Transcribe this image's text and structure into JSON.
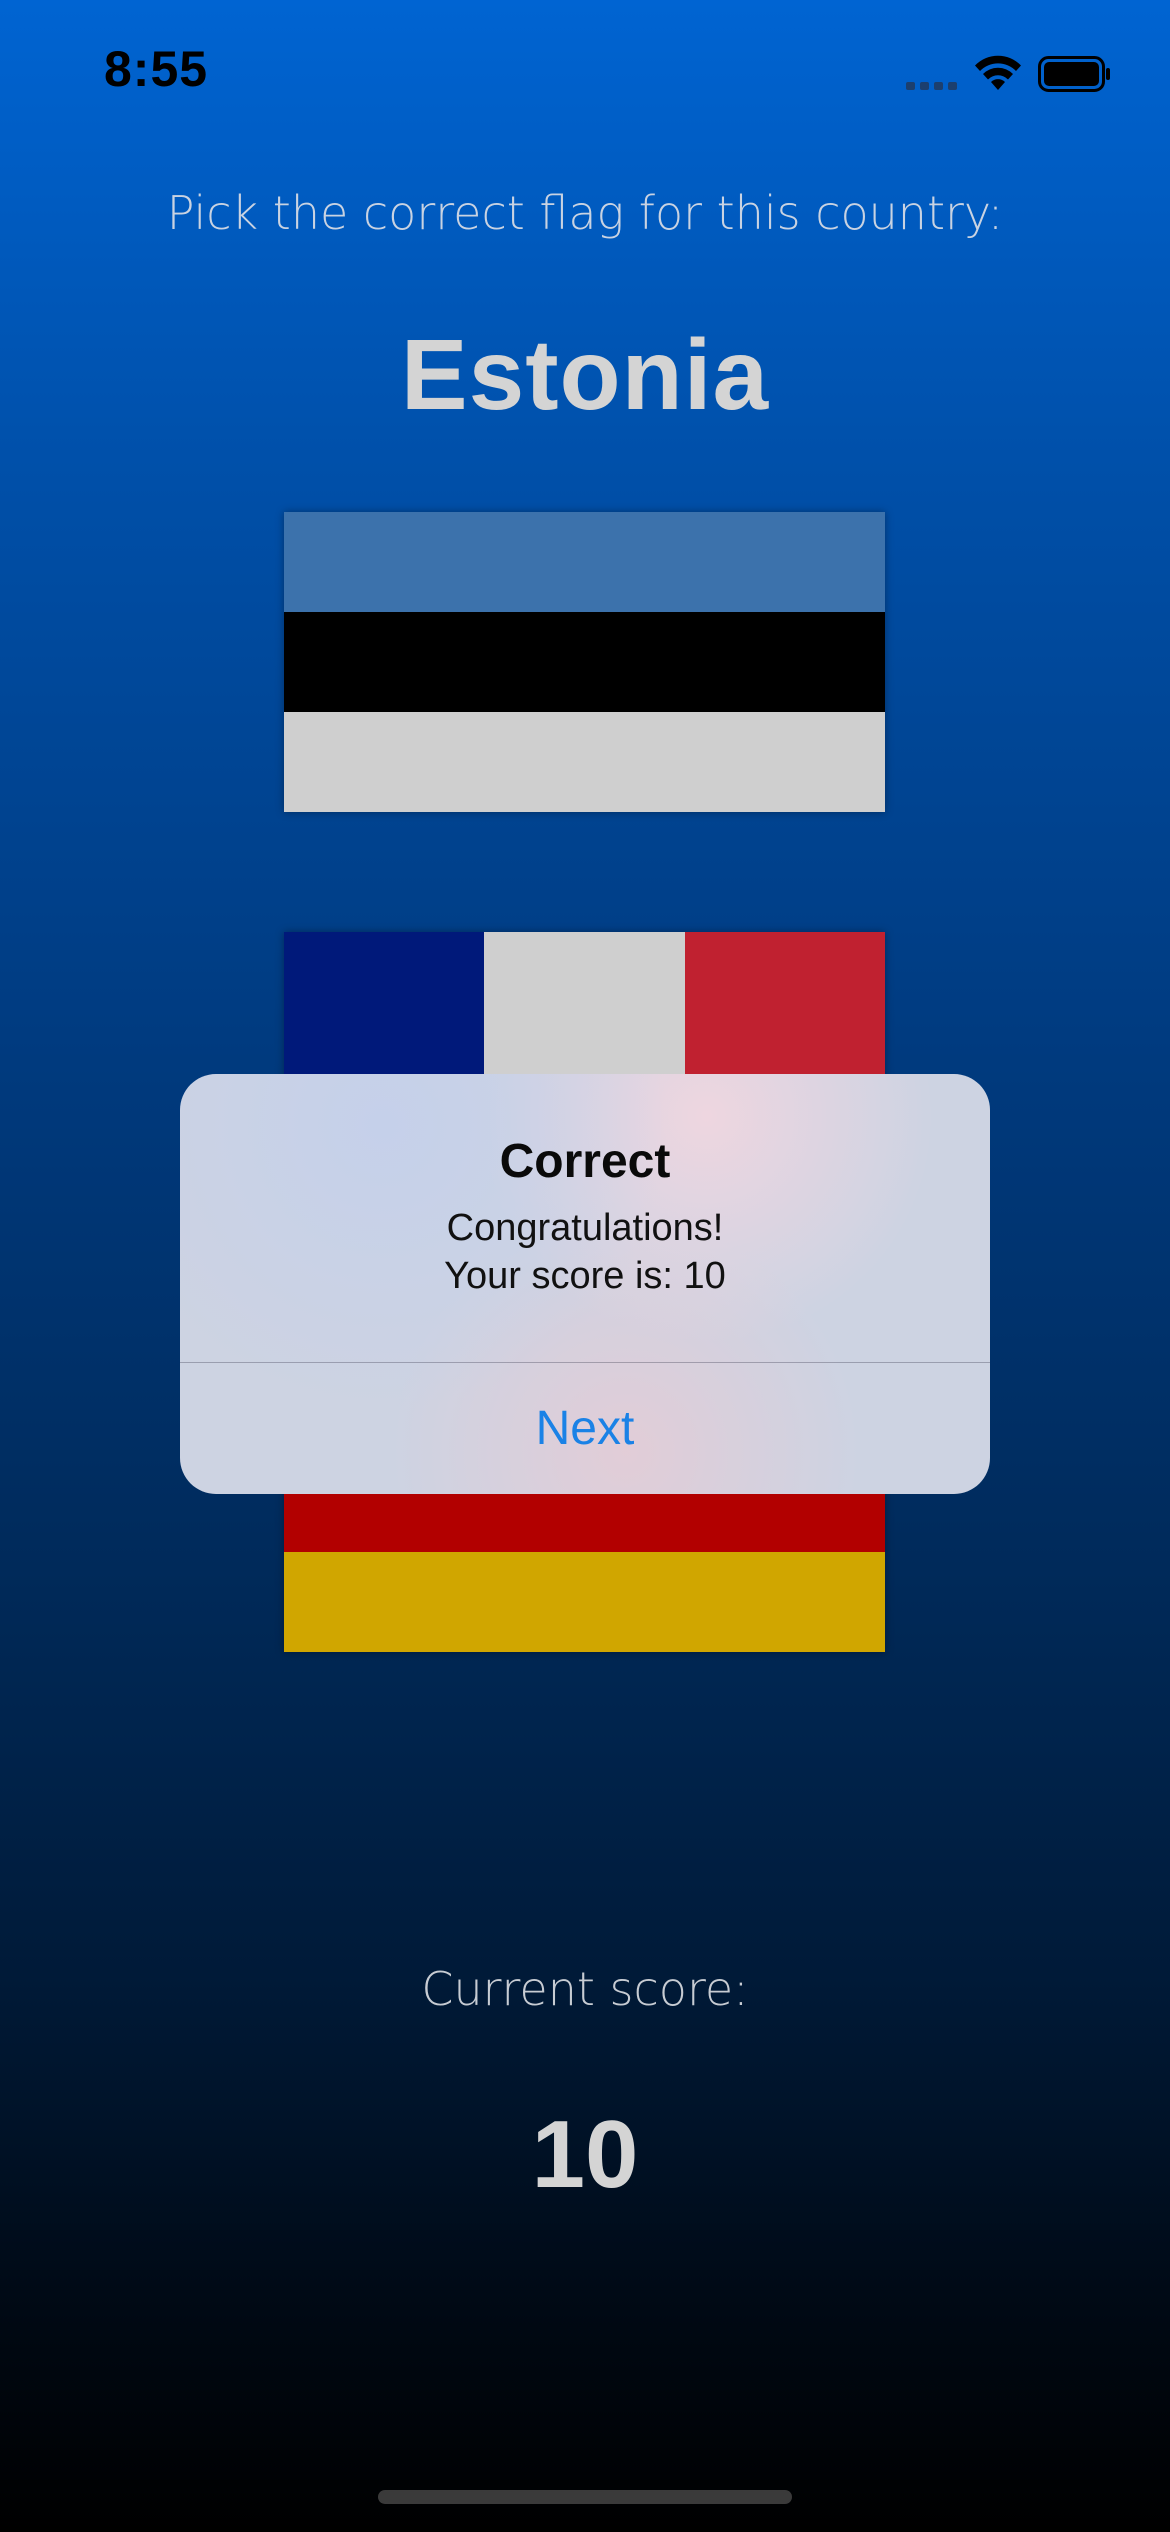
{
  "status_bar": {
    "time": "8:55"
  },
  "quiz": {
    "prompt": "Pick the correct flag for this country:",
    "country": "Estonia"
  },
  "flags": [
    {
      "name": "Estonia",
      "colors": [
        "#3c72ac",
        "#000000",
        "#cfcfcf"
      ]
    },
    {
      "name": "France",
      "colors": [
        "#00197a",
        "#cfcfcf",
        "#c02130"
      ]
    },
    {
      "name": "Germany",
      "colors": [
        "#000000",
        "#b20000",
        "#d0a600"
      ]
    }
  ],
  "alert": {
    "title": "Correct",
    "message": "Congratulations!\nYour score is: 10",
    "button_label": "Next"
  },
  "score": {
    "label": "Current score:",
    "value": "10"
  },
  "colors": {
    "accent": "#1a82e6",
    "text_light": "#d4d4d4"
  }
}
